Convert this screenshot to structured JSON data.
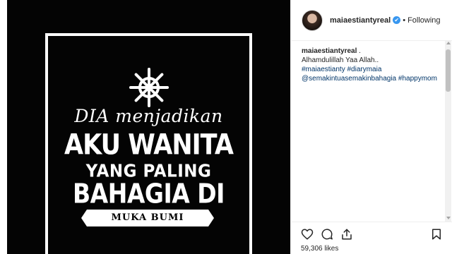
{
  "post": {
    "image_text": {
      "line1": "DIA menjadikan",
      "line2": "AKU WANITA",
      "line3": "YANG PALING",
      "line4": "BAHAGIA DI",
      "banner": "MUKA BUMI"
    }
  },
  "header": {
    "username": "maiaestiantyreal",
    "verified_glyph": "✔",
    "separator": "•",
    "follow_status": "Following"
  },
  "caption": {
    "username": "maiaestiantyreal",
    "suffix": ".",
    "text": "Alhamdulillah Yaa Allah..",
    "tags_line1": "#maiaestianty #diarymaia",
    "tags_line2": "@semakintuasemakinbahagia #happymom"
  },
  "footer": {
    "likes": "59,306 likes"
  },
  "icons": [
    "helm-icon",
    "verified-icon",
    "heart-icon",
    "comment-icon",
    "share-icon",
    "bookmark-icon"
  ],
  "colors": {
    "link": "#003569",
    "verified": "#3897f0",
    "text": "#262626"
  }
}
